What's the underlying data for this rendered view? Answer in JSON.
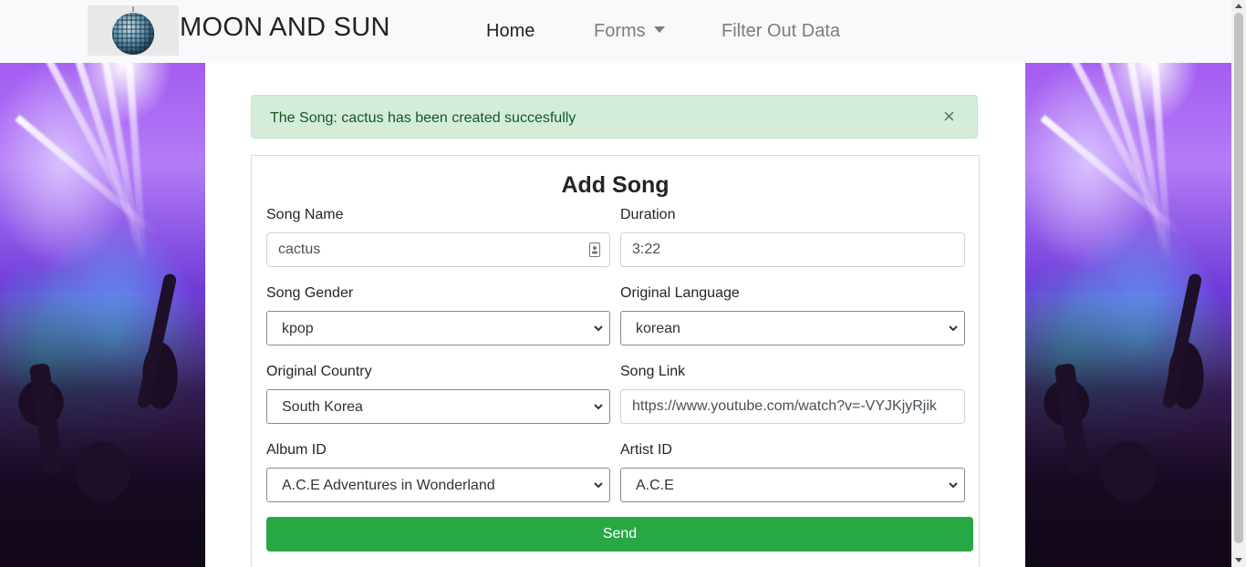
{
  "navbar": {
    "brand": "MOON AND SUN",
    "links": {
      "home": "Home",
      "forms": "Forms",
      "filter": "Filter Out Data"
    }
  },
  "alert": {
    "message": "The Song: cactus has been created succesfully",
    "close_symbol": "×"
  },
  "form": {
    "title": "Add Song",
    "song_name": {
      "label": "Song Name",
      "value": "cactus"
    },
    "duration": {
      "label": "Duration",
      "value": "3:22"
    },
    "song_gender": {
      "label": "Song Gender",
      "value": "kpop"
    },
    "original_language": {
      "label": "Original Language",
      "value": "korean"
    },
    "original_country": {
      "label": "Original Country",
      "value": "South Korea"
    },
    "song_link": {
      "label": "Song Link",
      "value": "https://www.youtube.com/watch?v=-VYJKjyRjik"
    },
    "album_id": {
      "label": "Album ID",
      "value": "A.C.E Adventures in Wonderland"
    },
    "artist_id": {
      "label": "Artist ID",
      "value": "A.C.E"
    },
    "submit_label": "Send"
  },
  "colors": {
    "success_green": "#28a745",
    "alert_bg": "#d4edda",
    "alert_text": "#155724",
    "navbar_bg": "#f8f9fa"
  },
  "icons": [
    "disco-ball-logo-icon",
    "caret-down-icon",
    "close-icon",
    "autofill-contact-icon",
    "chevron-down-icon"
  ]
}
